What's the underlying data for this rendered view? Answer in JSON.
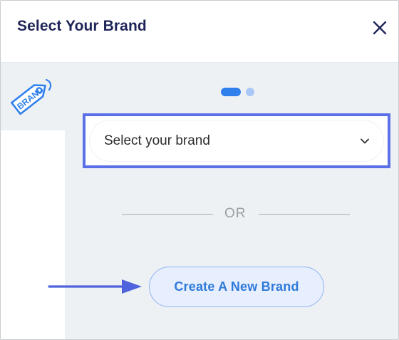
{
  "dialog": {
    "title": "Select Your Brand"
  },
  "sidebar": {
    "items": [
      {
        "icon": "brand-tag-icon",
        "tag_text": "BRAND"
      }
    ]
  },
  "steps": {
    "total": 2,
    "current": 1
  },
  "brand_select": {
    "placeholder": "Select your brand",
    "icon": "chevron-down-icon"
  },
  "divider": {
    "text": "OR"
  },
  "create_button": {
    "label": "Create A New Brand"
  },
  "colors": {
    "title": "#1f2557",
    "accent": "#2f80ed",
    "highlight": "#5b6fe6",
    "button_bg": "#e7efff",
    "button_text": "#2f7ad9",
    "panel_bg": "#eef1f4"
  }
}
